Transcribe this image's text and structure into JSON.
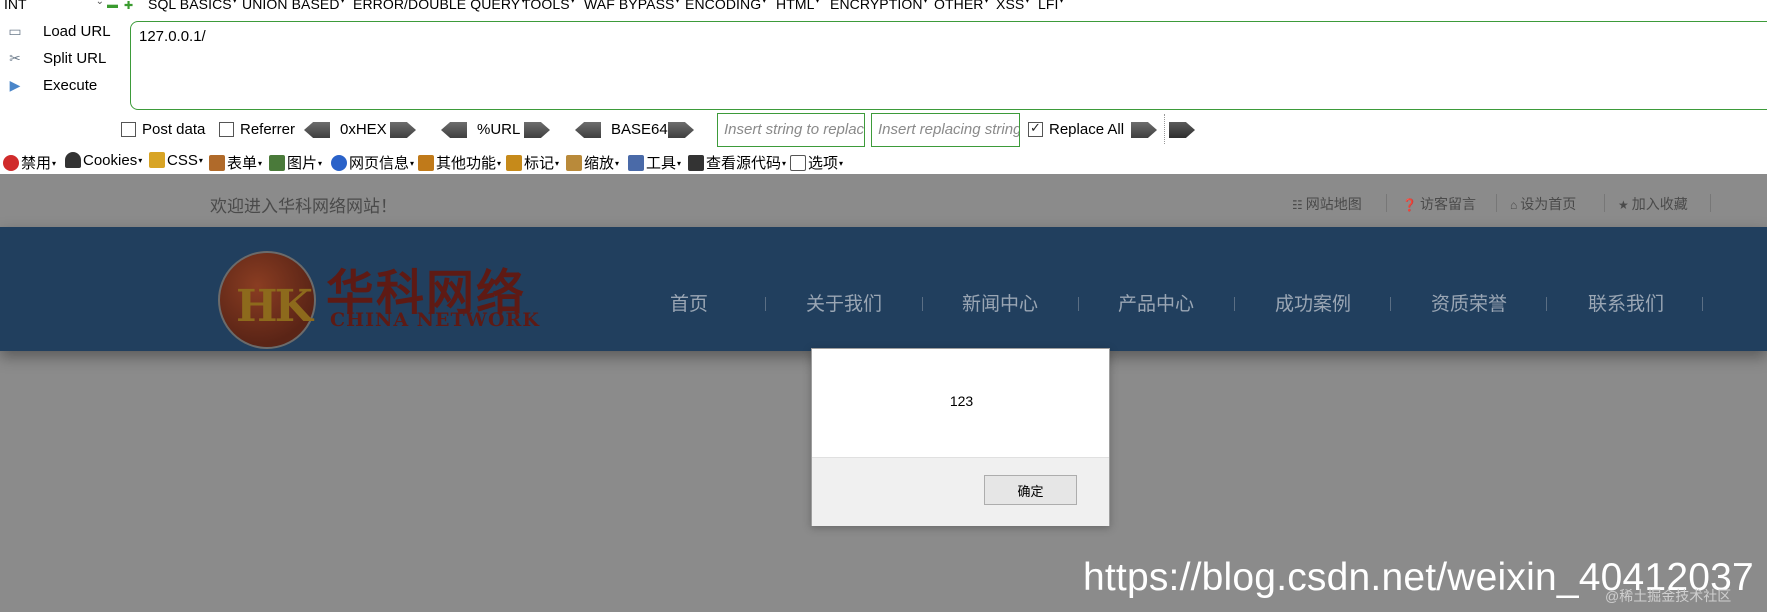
{
  "hackbar": {
    "select_value": "INT",
    "menu": [
      "SQL BASICS",
      "UNION BASED",
      "ERROR/DOUBLE QUERY",
      "TOOLS",
      "WAF BYPASS",
      "ENCODING",
      "HTML",
      "ENCRYPTION",
      "OTHER",
      "XSS",
      "LFI"
    ],
    "actions": {
      "load": "Load URL",
      "split": "Split URL",
      "execute": "Execute"
    },
    "url_value": "127.0.0.1/",
    "options": {
      "post_data": "Post data",
      "referrer": "Referrer",
      "hex": "0xHEX",
      "url": "%URL",
      "base64": "BASE64",
      "find_placeholder": "Insert string to replace",
      "replace_placeholder": "Insert replacing string",
      "replace_all": "Replace All",
      "post_checked": false,
      "referrer_checked": false,
      "replace_all_checked": true
    }
  },
  "webdev": {
    "items": [
      {
        "label": "禁用",
        "icon": "disable-icon",
        "color": "#d02b2b"
      },
      {
        "label": "Cookies",
        "icon": "cookie-icon",
        "color": "#333333"
      },
      {
        "label": "CSS",
        "icon": "css-wand-icon",
        "color": "#d8a425"
      },
      {
        "label": "表单",
        "icon": "form-icon",
        "color": "#b06a2a"
      },
      {
        "label": "图片",
        "icon": "image-icon",
        "color": "#4a7a3a"
      },
      {
        "label": "网页信息",
        "icon": "info-icon",
        "color": "#2a62c9"
      },
      {
        "label": "其他功能",
        "icon": "misc-icon",
        "color": "#c07a1a"
      },
      {
        "label": "标记",
        "icon": "pencil-icon",
        "color": "#c68a1a"
      },
      {
        "label": "缩放",
        "icon": "ruler-icon",
        "color": "#b98a3a"
      },
      {
        "label": "工具",
        "icon": "tools-icon",
        "color": "#4a6aa8"
      },
      {
        "label": "查看源代码",
        "icon": "source-icon",
        "color": "#333333"
      },
      {
        "label": "选项",
        "icon": "options-icon",
        "color": "#555555"
      }
    ]
  },
  "site": {
    "welcome": "欢迎进入华科网络网站！",
    "top_links": [
      {
        "label": "网站地图",
        "icon": "sitemap-icon"
      },
      {
        "label": "访客留言",
        "icon": "question-icon"
      },
      {
        "label": "设为首页",
        "icon": "home-icon"
      },
      {
        "label": "加入收藏",
        "icon": "star-icon"
      }
    ],
    "logo": {
      "mark": "HK",
      "cn": "华科网络",
      "en": "CHINA NETWORK"
    },
    "nav": [
      "首页",
      "关于我们",
      "新闻中心",
      "产品中心",
      "成功案例",
      "资质荣誉",
      "联系我们"
    ]
  },
  "dialog": {
    "message": "123",
    "ok_label": "确定"
  },
  "watermark": {
    "url": "https://blog.csdn.net/weixin_40412037",
    "sub": "@稀土掘金技术社区"
  },
  "colors": {
    "hackbar_border": "#3d9b3a",
    "nav_band": "#213f5e",
    "overlay": "#8b8b8b"
  }
}
